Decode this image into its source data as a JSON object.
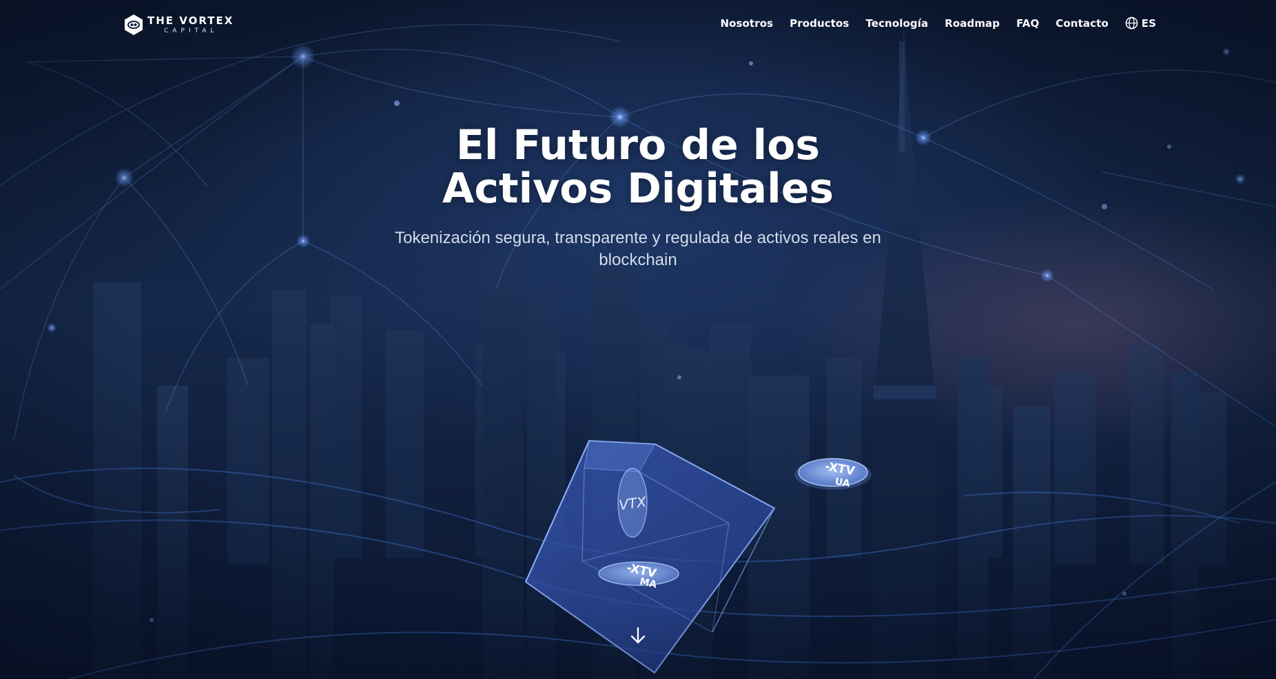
{
  "brand": {
    "name": "THE VORTEX",
    "sub": "CAPITAL",
    "icon": "vortex-hexagon-icon"
  },
  "nav": {
    "items": [
      {
        "label": "Nosotros"
      },
      {
        "label": "Productos"
      },
      {
        "label": "Tecnología"
      },
      {
        "label": "Roadmap"
      },
      {
        "label": "FAQ"
      },
      {
        "label": "Contacto"
      }
    ],
    "language": {
      "icon": "globe-icon",
      "label": "ES"
    }
  },
  "hero": {
    "title_line1": "El Futuro de los",
    "title_line2": "Activos Digitales",
    "subtitle": "Tokenización segura, transparente y regulada de activos reales en blockchain",
    "scroll_icon": "arrow-down-icon"
  },
  "tokens": {
    "cube_face_label": "VTX",
    "cube_coin_line1": "-XTV",
    "cube_coin_line2": "MA",
    "floating_coin_line1": "-XTV",
    "floating_coin_line2": "UA"
  },
  "colors": {
    "background": "#0f2040",
    "accent_glow": "#6fa0ff",
    "text": "#ffffff",
    "subtitle": "#d3dcea"
  }
}
